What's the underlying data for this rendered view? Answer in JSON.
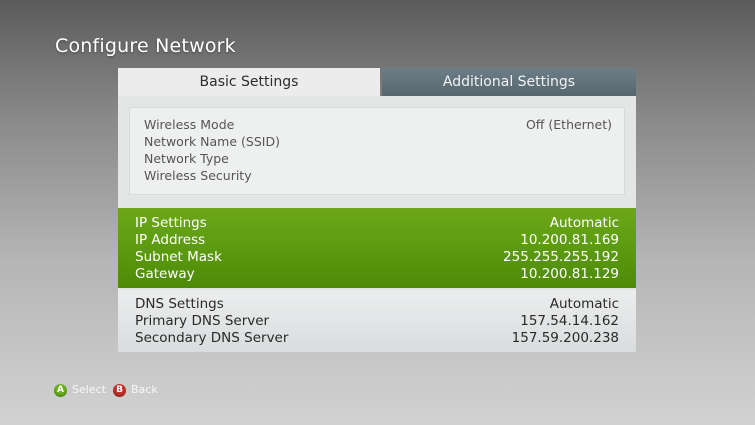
{
  "page": {
    "title": "Configure Network"
  },
  "tabs": [
    {
      "label": "Basic Settings",
      "selected": true
    },
    {
      "label": "Additional Settings",
      "selected": false
    }
  ],
  "wireless": [
    {
      "label": "Wireless Mode",
      "value": "Off (Ethernet)"
    },
    {
      "label": "Network Name (SSID)",
      "value": ""
    },
    {
      "label": "Network Type",
      "value": ""
    },
    {
      "label": "Wireless Security",
      "value": ""
    }
  ],
  "ip": [
    {
      "label": "IP Settings",
      "value": "Automatic"
    },
    {
      "label": "IP Address",
      "value": "10.200.81.169"
    },
    {
      "label": "Subnet Mask",
      "value": "255.255.255.192"
    },
    {
      "label": "Gateway",
      "value": "10.200.81.129"
    }
  ],
  "dns": [
    {
      "label": "DNS Settings",
      "value": "Automatic"
    },
    {
      "label": "Primary DNS Server",
      "value": "157.54.14.162"
    },
    {
      "label": "Secondary DNS Server",
      "value": "157.59.200.238"
    }
  ],
  "footer": {
    "a_letter": "A",
    "a_label": "Select",
    "b_letter": "B",
    "b_label": "Back"
  },
  "colors": {
    "highlight_green": "#5c9b10",
    "tab_inactive": "#5f6f78",
    "button_a": "#6bb01e",
    "button_b": "#c4302b"
  }
}
